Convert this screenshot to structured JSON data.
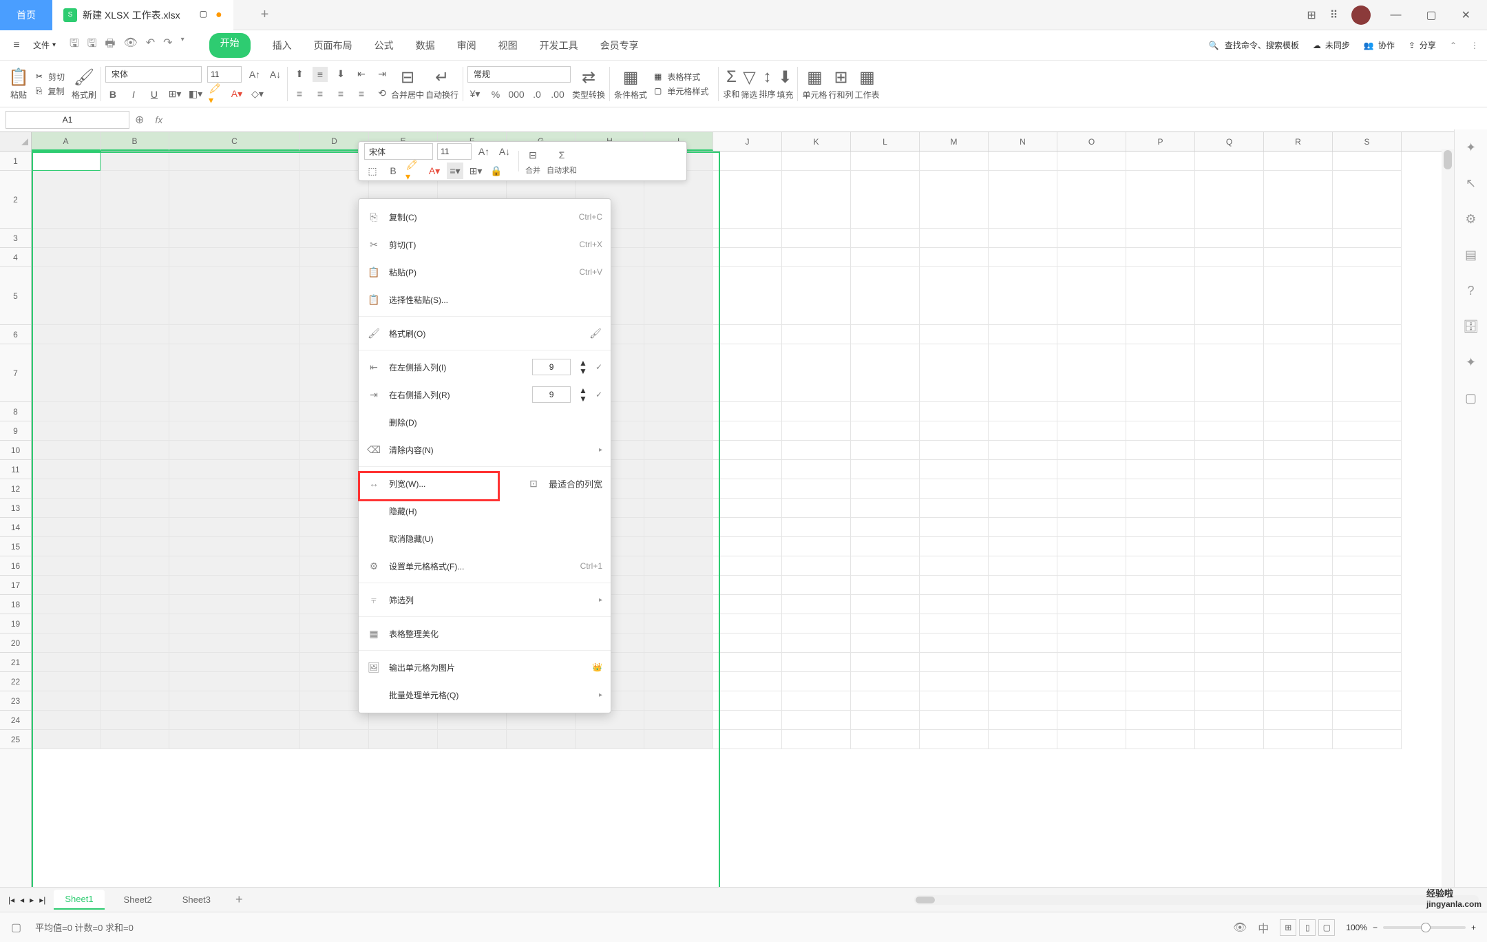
{
  "titlebar": {
    "home_tab": "首页",
    "doc_icon": "S",
    "doc_name": "新建 XLSX 工作表.xlsx",
    "plus": "+"
  },
  "menubar": {
    "file": "文件",
    "tabs": [
      "开始",
      "插入",
      "页面布局",
      "公式",
      "数据",
      "审阅",
      "视图",
      "开发工具",
      "会员专享"
    ],
    "search_placeholder": "查找命令、搜索模板",
    "unsync": "未同步",
    "collab": "协作",
    "share": "分享"
  },
  "ribbon": {
    "paste": "粘贴",
    "cut": "剪切",
    "copy": "复制",
    "format_painter": "格式刷",
    "font_name": "宋体",
    "font_size": "11",
    "merge_center": "合并居中",
    "wrap": "自动换行",
    "number_format": "常规",
    "type_convert": "类型转换",
    "cond_format": "条件格式",
    "table_style": "表格样式",
    "cell_style": "单元格样式",
    "sum": "求和",
    "filter": "筛选",
    "sort": "排序",
    "fill": "填充",
    "cells": "单元格",
    "rowcol": "行和列",
    "worksheet": "工作表"
  },
  "formula_bar": {
    "name_box": "A1",
    "fx": "fx"
  },
  "float_toolbar": {
    "font_name": "宋体",
    "font_size": "11",
    "merge": "合并",
    "autosum": "自动求和"
  },
  "context_menu": {
    "copy": "复制(C)",
    "copy_sc": "Ctrl+C",
    "cut": "剪切(T)",
    "cut_sc": "Ctrl+X",
    "paste": "粘贴(P)",
    "paste_sc": "Ctrl+V",
    "paste_special": "选择性粘贴(S)...",
    "format_painter": "格式刷(O)",
    "insert_left": "在左侧插入列(I)",
    "insert_left_val": "9",
    "insert_right": "在右侧插入列(R)",
    "insert_right_val": "9",
    "delete": "删除(D)",
    "clear": "清除内容(N)",
    "col_width": "列宽(W)...",
    "best_fit": "最适合的列宽",
    "hide": "隐藏(H)",
    "unhide": "取消隐藏(U)",
    "format_cells": "设置单元格格式(F)...",
    "format_cells_sc": "Ctrl+1",
    "filter_col": "筛选列",
    "table_beautify": "表格整理美化",
    "export_image": "输出单元格为图片",
    "batch_process": "批量处理单元格(Q)"
  },
  "columns": [
    "A",
    "B",
    "C",
    "D",
    "E",
    "F",
    "G",
    "H",
    "I",
    "J",
    "K",
    "L",
    "M",
    "N",
    "O",
    "P",
    "Q",
    "R",
    "S"
  ],
  "rows": [
    "1",
    "2",
    "3",
    "4",
    "5",
    "6",
    "7",
    "8",
    "9",
    "10",
    "11",
    "12",
    "13",
    "14",
    "15",
    "16",
    "17",
    "18",
    "19",
    "20",
    "21",
    "22",
    "23",
    "24",
    "25"
  ],
  "sheet_tabs": {
    "tabs": [
      "Sheet1",
      "Sheet2",
      "Sheet3"
    ],
    "active": 0
  },
  "statusbar": {
    "stats": "平均值=0  计数=0  求和=0",
    "zoom": "100%"
  },
  "watermark": {
    "top": "经验啦",
    "bottom": "jingyanla.com"
  }
}
